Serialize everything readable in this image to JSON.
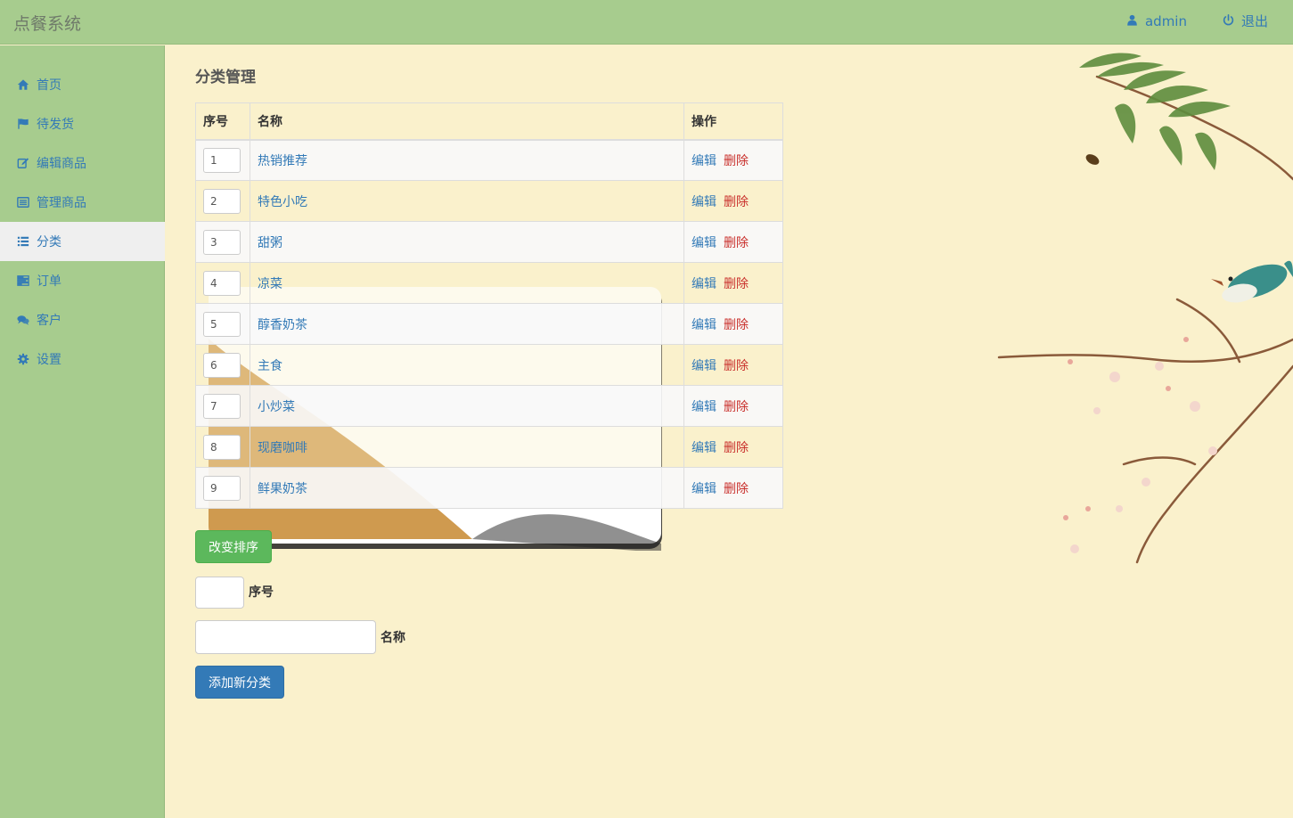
{
  "brand": "点餐系统",
  "user": {
    "name": "admin",
    "logout": "退出"
  },
  "sidebar": {
    "items": [
      {
        "label": "首页",
        "icon": "home-icon"
      },
      {
        "label": "待发货",
        "icon": "flag-icon"
      },
      {
        "label": "编辑商品",
        "icon": "edit-icon"
      },
      {
        "label": "管理商品",
        "icon": "list-alt-icon"
      },
      {
        "label": "分类",
        "icon": "list-icon",
        "active": true
      },
      {
        "label": "订单",
        "icon": "tasks-icon"
      },
      {
        "label": "客户",
        "icon": "comments-icon"
      },
      {
        "label": "设置",
        "icon": "gear-icon"
      }
    ]
  },
  "page": {
    "title": "分类管理"
  },
  "table": {
    "headers": [
      "序号",
      "名称",
      "操作"
    ],
    "rows": [
      {
        "order": "1",
        "name": "热销推荐"
      },
      {
        "order": "2",
        "name": "特色小吃"
      },
      {
        "order": "3",
        "name": "甜粥"
      },
      {
        "order": "4",
        "name": "凉菜"
      },
      {
        "order": "5",
        "name": "醇香奶茶"
      },
      {
        "order": "6",
        "name": "主食"
      },
      {
        "order": "7",
        "name": "小炒菜"
      },
      {
        "order": "8",
        "name": "现磨咖啡"
      },
      {
        "order": "9",
        "name": "鲜果奶茶"
      }
    ],
    "edit_label": "编辑",
    "delete_label": "删除"
  },
  "actions": {
    "reorder_label": "改变排序",
    "order_field_label": "序号",
    "name_field_label": "名称",
    "add_label": "添加新分类"
  },
  "colors": {
    "header_bg": "#a7cc8e",
    "page_bg": "#faf1cc",
    "link": "#337ab7",
    "danger": "#c9302c",
    "success": "#5cb85c"
  }
}
